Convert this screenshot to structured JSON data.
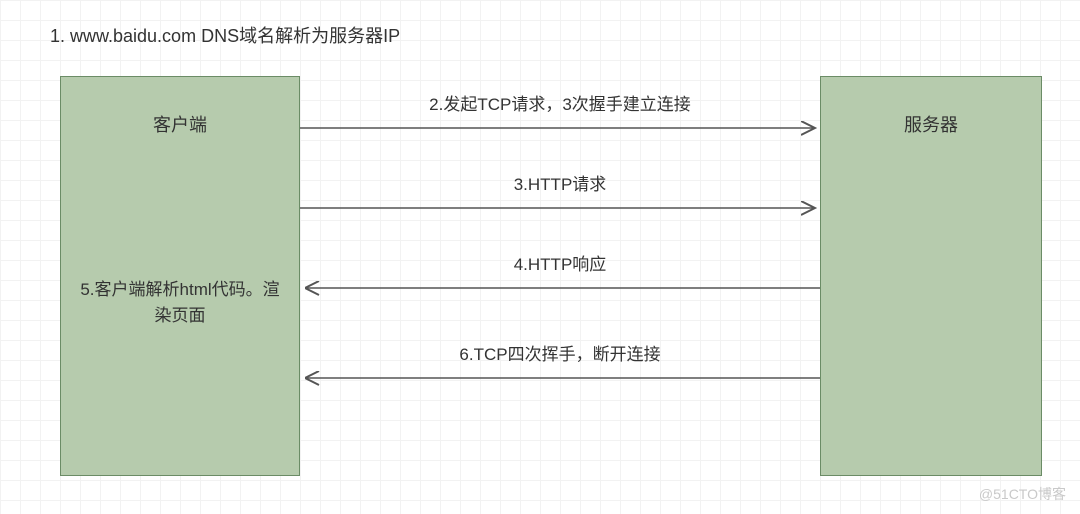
{
  "title": "1. www.baidu.com DNS域名解析为服务器IP",
  "client": {
    "label": "客户端",
    "note": "5.客户端解析html代码。渲染页面"
  },
  "server": {
    "label": "服务器"
  },
  "arrows": {
    "a2": "2.发起TCP请求，3次握手建立连接",
    "a3": "3.HTTP请求",
    "a4": "4.HTTP响应",
    "a6": "6.TCP四次挥手，断开连接"
  },
  "watermark": "@51CTO博客"
}
